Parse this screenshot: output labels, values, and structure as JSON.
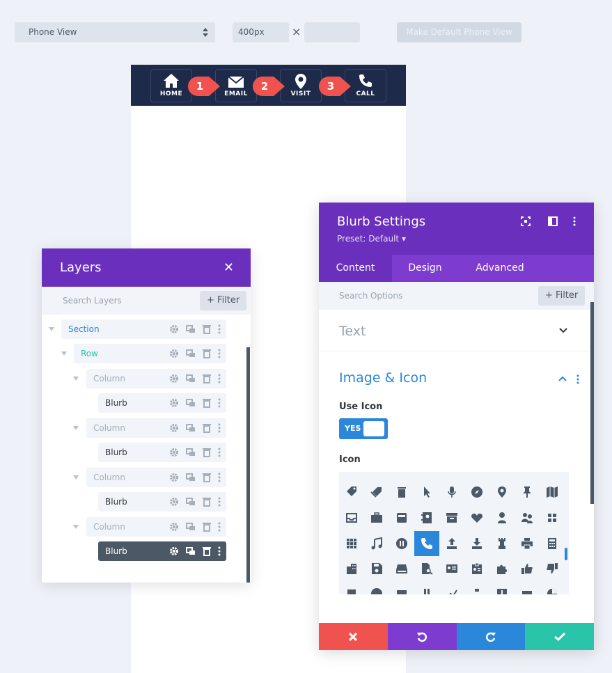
{
  "toolbar": {
    "view_select": "Phone View",
    "width_value": "400px",
    "height_value": "",
    "times_symbol": "×",
    "default_button": "Make Default Phone View"
  },
  "phone_nav": {
    "items": [
      {
        "label": "HOME",
        "icon": "home-icon"
      },
      {
        "label": "EMAIL",
        "icon": "envelope-icon"
      },
      {
        "label": "VISIT",
        "icon": "map-pin-icon"
      },
      {
        "label": "CALL",
        "icon": "phone-icon"
      }
    ],
    "markers": [
      "1",
      "2",
      "3"
    ],
    "marker_color": "#f0534f",
    "bar_color": "#1e2a4a"
  },
  "layers": {
    "title": "Layers",
    "search_placeholder": "Search Layers",
    "filter_label": "Filter",
    "rows": [
      {
        "label": "Section"
      },
      {
        "label": "Row"
      },
      {
        "label": "Column"
      },
      {
        "label": "Blurb"
      },
      {
        "label": "Column"
      },
      {
        "label": "Blurb"
      },
      {
        "label": "Column"
      },
      {
        "label": "Blurb"
      },
      {
        "label": "Column"
      },
      {
        "label": "Blurb"
      }
    ]
  },
  "settings": {
    "title": "Blurb Settings",
    "preset": "Preset: Default",
    "tabs": [
      "Content",
      "Design",
      "Advanced"
    ],
    "search_placeholder": "Search Options",
    "filter_label": "Filter",
    "section_text": "Text",
    "section_image_icon": "Image & Icon",
    "use_icon_label": "Use Icon",
    "toggle_value": "YES",
    "icon_label": "Icon",
    "accent": "#2b87da",
    "header_color": "#6a2fbc",
    "footer_colors": [
      "#f0534f",
      "#7e3bd0",
      "#2b87da",
      "#29c4a9"
    ]
  }
}
